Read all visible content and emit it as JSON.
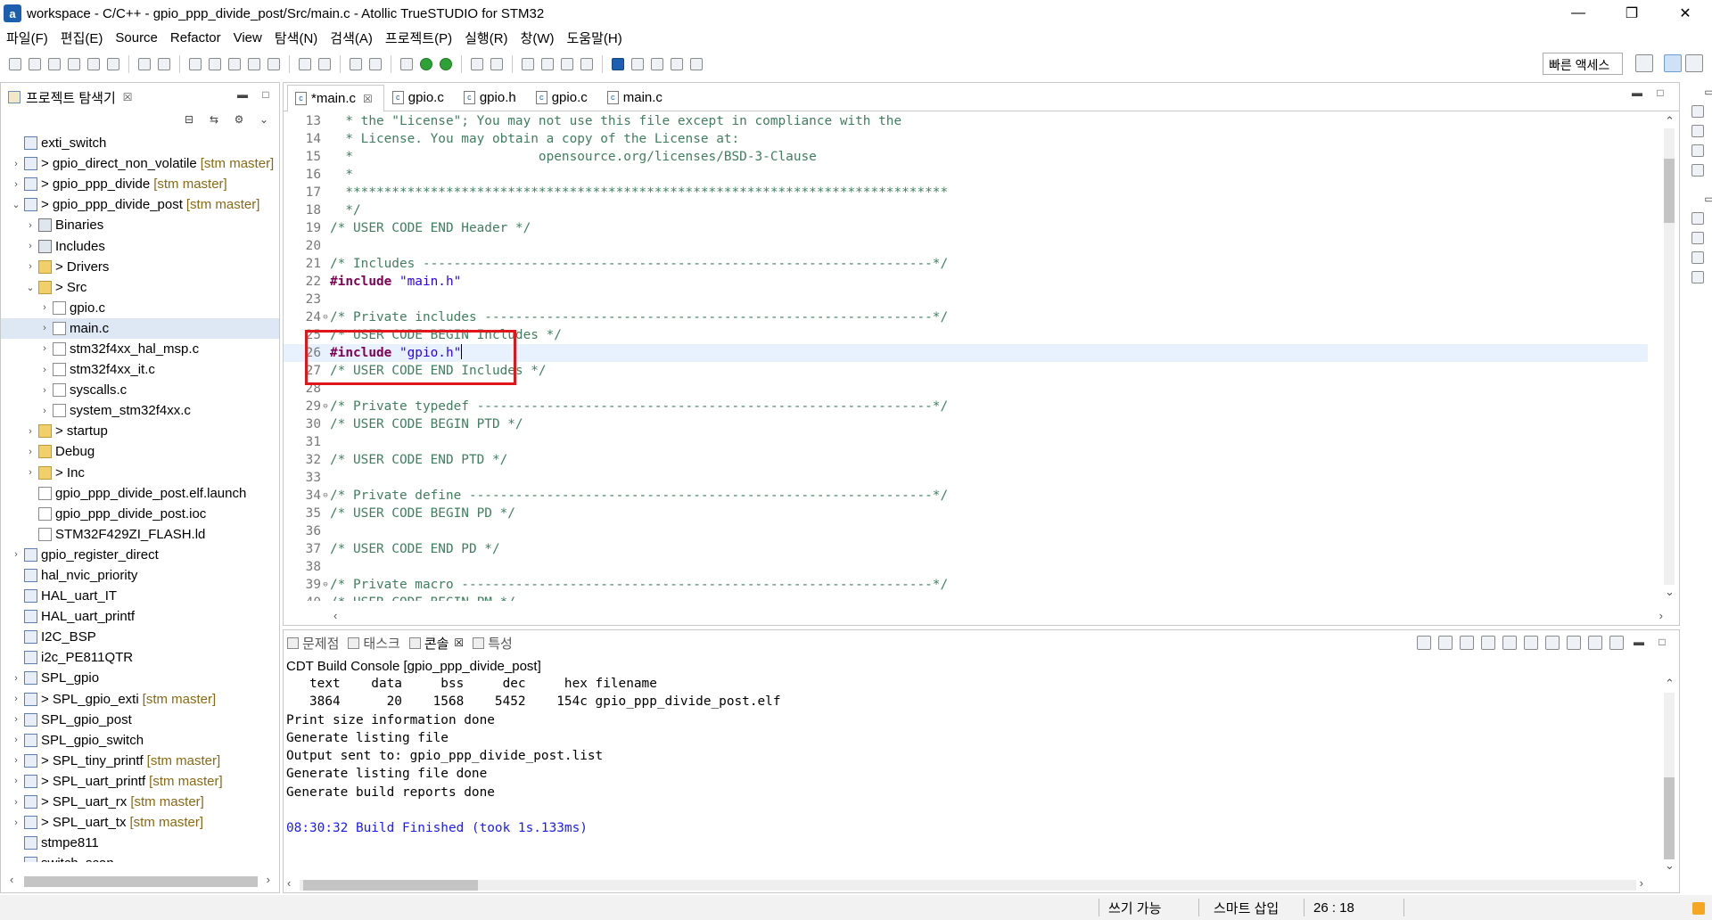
{
  "window": {
    "title": "workspace - C/C++ - gpio_ppp_divide_post/Src/main.c - Atollic TrueSTUDIO for STM32",
    "min": "—",
    "max": "❐",
    "close": "✕"
  },
  "menu": [
    "파일(F)",
    "편집(E)",
    "Source",
    "Refactor",
    "View",
    "탐색(N)",
    "검색(A)",
    "프로젝트(P)",
    "실행(R)",
    "창(W)",
    "도움말(H)"
  ],
  "toolbar": {
    "quick_access": "빠른 액세스"
  },
  "explorer": {
    "title": "프로젝트 탐색기",
    "tab_close": "☒",
    "tree": [
      {
        "label": "exti_switch",
        "twisty": "",
        "indent": 0,
        "icon": "project-icon"
      },
      {
        "label": "> gpio_direct_non_volatile",
        "git": "[stm master]",
        "twisty": "›",
        "indent": 0,
        "icon": "project-icon"
      },
      {
        "label": "> gpio_ppp_divide",
        "git": "[stm master]",
        "twisty": "›",
        "indent": 0,
        "icon": "project-icon"
      },
      {
        "label": "> gpio_ppp_divide_post",
        "git": "[stm master]",
        "twisty": "⌄",
        "indent": 0,
        "icon": "project-icon"
      },
      {
        "label": "Binaries",
        "twisty": "›",
        "indent": 1,
        "icon": "binaries-icon"
      },
      {
        "label": "Includes",
        "twisty": "›",
        "indent": 1,
        "icon": "includes-icon"
      },
      {
        "label": "> Drivers",
        "twisty": "›",
        "indent": 1,
        "icon": "folder-icon"
      },
      {
        "label": "> Src",
        "twisty": "⌄",
        "indent": 1,
        "icon": "folder-icon"
      },
      {
        "label": "gpio.c",
        "twisty": "›",
        "indent": 2,
        "icon": "c-file-icon"
      },
      {
        "label": "main.c",
        "twisty": "›",
        "indent": 2,
        "icon": "c-file-icon",
        "selected": true
      },
      {
        "label": "stm32f4xx_hal_msp.c",
        "twisty": "›",
        "indent": 2,
        "icon": "c-file-icon"
      },
      {
        "label": "stm32f4xx_it.c",
        "twisty": "›",
        "indent": 2,
        "icon": "c-file-icon"
      },
      {
        "label": "syscalls.c",
        "twisty": "›",
        "indent": 2,
        "icon": "c-file-icon"
      },
      {
        "label": "system_stm32f4xx.c",
        "twisty": "›",
        "indent": 2,
        "icon": "c-file-icon"
      },
      {
        "label": "> startup",
        "twisty": "›",
        "indent": 1,
        "icon": "folder-icon"
      },
      {
        "label": "Debug",
        "twisty": "›",
        "indent": 1,
        "icon": "folder-icon"
      },
      {
        "label": "> Inc",
        "twisty": "›",
        "indent": 1,
        "icon": "folder-icon"
      },
      {
        "label": "gpio_ppp_divide_post.elf.launch",
        "twisty": "",
        "indent": 1,
        "icon": "file-icon"
      },
      {
        "label": "gpio_ppp_divide_post.ioc",
        "twisty": "",
        "indent": 1,
        "icon": "file-icon"
      },
      {
        "label": "STM32F429ZI_FLASH.ld",
        "twisty": "",
        "indent": 1,
        "icon": "file-icon"
      },
      {
        "label": "gpio_register_direct",
        "twisty": "›",
        "indent": 0,
        "icon": "project-icon"
      },
      {
        "label": "hal_nvic_priority",
        "twisty": "",
        "indent": 0,
        "icon": "project-icon"
      },
      {
        "label": "HAL_uart_IT",
        "twisty": "",
        "indent": 0,
        "icon": "project-icon"
      },
      {
        "label": "HAL_uart_printf",
        "twisty": "",
        "indent": 0,
        "icon": "project-icon"
      },
      {
        "label": "I2C_BSP",
        "twisty": "",
        "indent": 0,
        "icon": "project-icon"
      },
      {
        "label": "i2c_PE811QTR",
        "twisty": "",
        "indent": 0,
        "icon": "project-icon"
      },
      {
        "label": "SPL_gpio",
        "twisty": "›",
        "indent": 0,
        "icon": "project-icon"
      },
      {
        "label": "> SPL_gpio_exti",
        "git": "[stm master]",
        "twisty": "›",
        "indent": 0,
        "icon": "project-icon"
      },
      {
        "label": "SPL_gpio_post",
        "twisty": "›",
        "indent": 0,
        "icon": "project-icon"
      },
      {
        "label": "SPL_gpio_switch",
        "twisty": "›",
        "indent": 0,
        "icon": "project-icon"
      },
      {
        "label": "> SPL_tiny_printf",
        "git": "[stm master]",
        "twisty": "›",
        "indent": 0,
        "icon": "project-icon"
      },
      {
        "label": "> SPL_uart_printf",
        "git": "[stm master]",
        "twisty": "›",
        "indent": 0,
        "icon": "project-icon"
      },
      {
        "label": "> SPL_uart_rx",
        "git": "[stm master]",
        "twisty": "›",
        "indent": 0,
        "icon": "project-icon"
      },
      {
        "label": "> SPL_uart_tx",
        "git": "[stm master]",
        "twisty": "›",
        "indent": 0,
        "icon": "project-icon"
      },
      {
        "label": "stmpe811",
        "twisty": "",
        "indent": 0,
        "icon": "project-icon"
      },
      {
        "label": "switch_scan",
        "twisty": "",
        "indent": 0,
        "icon": "project-icon"
      }
    ]
  },
  "editor": {
    "tabs": [
      {
        "label": "*main.c",
        "active": true,
        "close": "☒"
      },
      {
        "label": "gpio.c"
      },
      {
        "label": "gpio.h"
      },
      {
        "label": "gpio.c"
      },
      {
        "label": "main.c"
      }
    ],
    "lines": [
      {
        "n": "13",
        "text": "  * the \"License\"; You may not use this file except in compliance with the",
        "kind": "comment"
      },
      {
        "n": "14",
        "text": "  * License. You may obtain a copy of the License at:",
        "kind": "comment"
      },
      {
        "n": "15",
        "text": "  *                        opensource.org/licenses/BSD-3-Clause",
        "kind": "comment"
      },
      {
        "n": "16",
        "text": "  *",
        "kind": "comment"
      },
      {
        "n": "17",
        "text": "  ******************************************************************************",
        "kind": "comment"
      },
      {
        "n": "18",
        "text": "  */",
        "kind": "comment"
      },
      {
        "n": "19",
        "text": "/* USER CODE END Header */",
        "kind": "comment"
      },
      {
        "n": "20",
        "text": "",
        "kind": "comment"
      },
      {
        "n": "21",
        "text": "/* Includes ------------------------------------------------------------------*/",
        "kind": "comment"
      },
      {
        "n": "22",
        "text": "#include ",
        "str": "\"main.h\"",
        "kind": "directive"
      },
      {
        "n": "23",
        "text": "",
        "kind": "comment"
      },
      {
        "n": "24",
        "fold": "⊖",
        "text": "/* Private includes ----------------------------------------------------------*/",
        "kind": "comment"
      },
      {
        "n": "25",
        "text": "/* USER CODE BEGIN Includes */",
        "kind": "comment"
      },
      {
        "n": "26",
        "text": "#include ",
        "str": "\"gpio.h\"",
        "kind": "directive",
        "current": true,
        "caret": true
      },
      {
        "n": "27",
        "text": "/* USER CODE END Includes */",
        "kind": "comment"
      },
      {
        "n": "28",
        "text": "",
        "kind": "comment"
      },
      {
        "n": "29",
        "fold": "⊖",
        "text": "/* Private typedef -----------------------------------------------------------*/",
        "kind": "comment"
      },
      {
        "n": "30",
        "text": "/* USER CODE BEGIN PTD */",
        "kind": "comment"
      },
      {
        "n": "31",
        "text": "",
        "kind": "comment"
      },
      {
        "n": "32",
        "text": "/* USER CODE END PTD */",
        "kind": "comment"
      },
      {
        "n": "33",
        "text": "",
        "kind": "comment"
      },
      {
        "n": "34",
        "fold": "⊖",
        "text": "/* Private define ------------------------------------------------------------*/",
        "kind": "comment"
      },
      {
        "n": "35",
        "text": "/* USER CODE BEGIN PD */",
        "kind": "comment"
      },
      {
        "n": "36",
        "text": "",
        "kind": "comment"
      },
      {
        "n": "37",
        "text": "/* USER CODE END PD */",
        "kind": "comment"
      },
      {
        "n": "38",
        "text": "",
        "kind": "comment"
      },
      {
        "n": "39",
        "fold": "⊖",
        "text": "/* Private macro -------------------------------------------------------------*/",
        "kind": "comment"
      },
      {
        "n": "40",
        "text": "/* USER CODE BEGIN PM */",
        "kind": "comment"
      }
    ]
  },
  "console": {
    "tabs": [
      {
        "label": "문제점"
      },
      {
        "label": "태스크"
      },
      {
        "label": "콘솔",
        "active": true,
        "close": "☒"
      },
      {
        "label": "특성"
      }
    ],
    "title": "CDT Build Console [gpio_ppp_divide_post]",
    "lines": [
      "   text    data     bss     dec     hex filename",
      "   3864      20    1568    5452    154c gpio_ppp_divide_post.elf",
      "Print size information done",
      "Generate listing file",
      "Output sent to: gpio_ppp_divide_post.list",
      "Generate listing file done",
      "Generate build reports done",
      ""
    ],
    "finished": "08:30:32 Build Finished (took 1s.133ms)"
  },
  "status": {
    "writable": "쓰기 가능",
    "insert_mode": "스마트 삽입",
    "position": "26 : 18"
  },
  "colors": {
    "comment": "#3f7f5f",
    "directive": "#7f0055",
    "string": "#2a00ff",
    "current_line": "#e8f2fe",
    "highlight_box": "#e0161b",
    "build_finished": "#1a1aff"
  }
}
